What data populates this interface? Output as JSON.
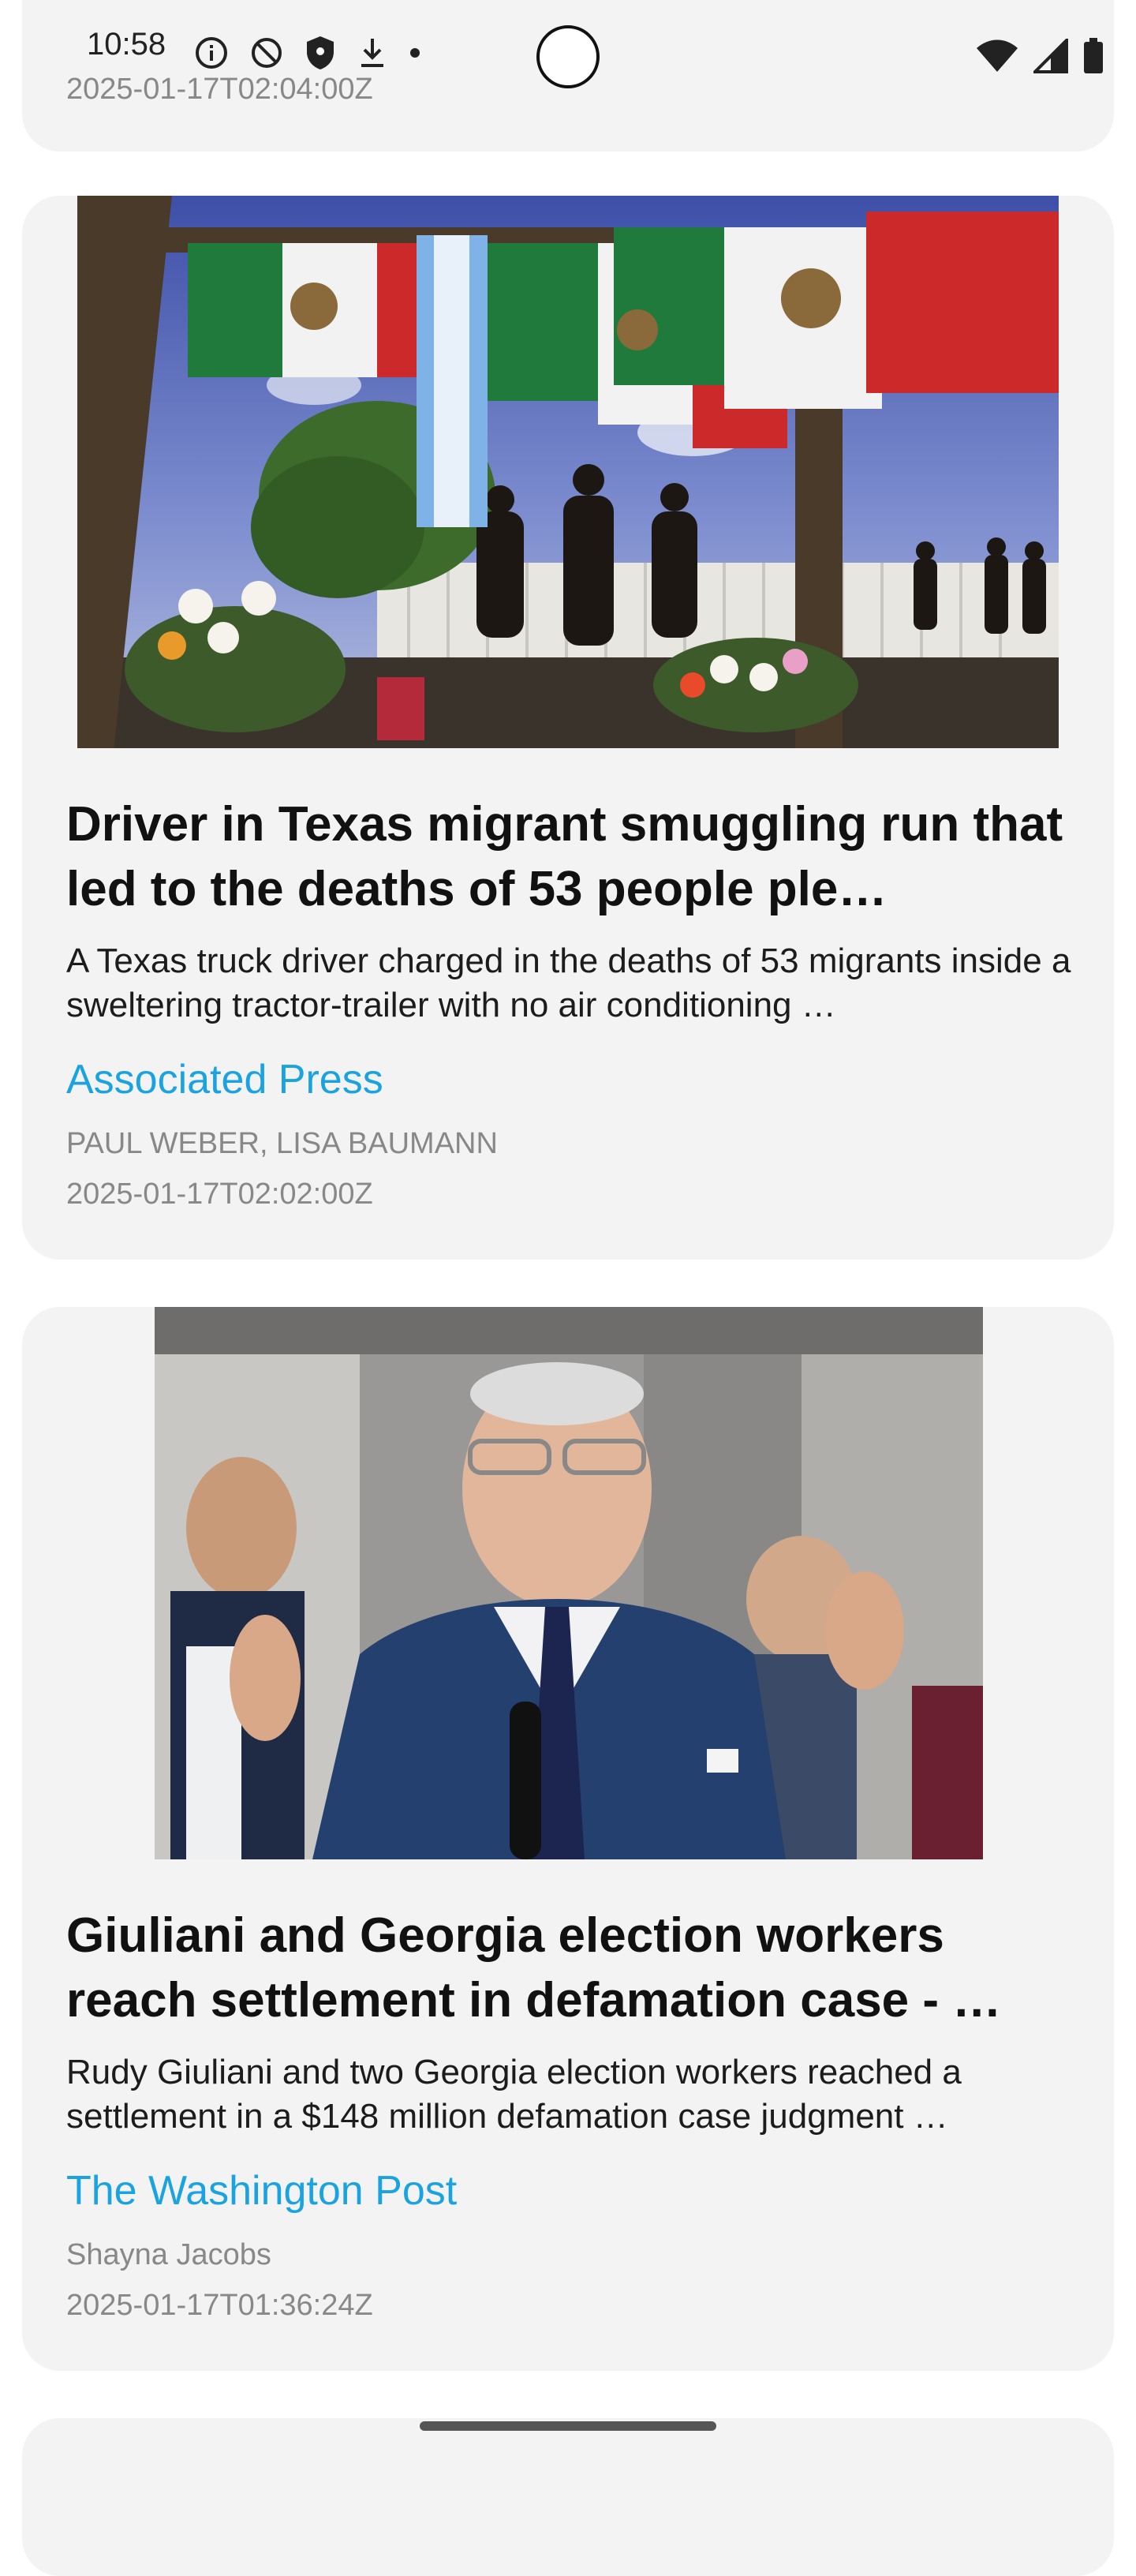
{
  "status_bar": {
    "time": "10:58",
    "icons_left": [
      "info-icon",
      "no-disturb-icon",
      "shield-icon",
      "download-icon",
      "dot-icon"
    ],
    "icons_right": [
      "wifi-icon",
      "cell-signal-icon",
      "battery-icon"
    ]
  },
  "feed": {
    "previous_article": {
      "date": "2025-01-17T02:04:00Z"
    },
    "articles": [
      {
        "image": "photo-memorial-flags-friars",
        "headline": "Driver in Texas migrant smuggling run that led to the deaths of 53 people ple…",
        "summary": "A Texas truck driver charged in the deaths of 53 migrants inside a sweltering tractor-trailer with no air conditioning …",
        "source": "Associated Press",
        "authors": "PAUL WEBER, LISA BAUMANN",
        "date": "2025-01-17T02:02:00Z"
      },
      {
        "image": "photo-giuliani-press",
        "headline": "Giuliani and Georgia election workers reach settlement in defamation case - …",
        "summary": "Rudy Giuliani and two Georgia election workers reached a settlement in a $148 million defamation case judgment …",
        "source": "The Washington Post",
        "authors": "Shayna Jacobs",
        "date": "2025-01-17T01:36:24Z"
      }
    ]
  },
  "colors": {
    "card_background": "#f3f3f3",
    "source_link": "#1aa3e0",
    "meta_text": "#888888"
  }
}
